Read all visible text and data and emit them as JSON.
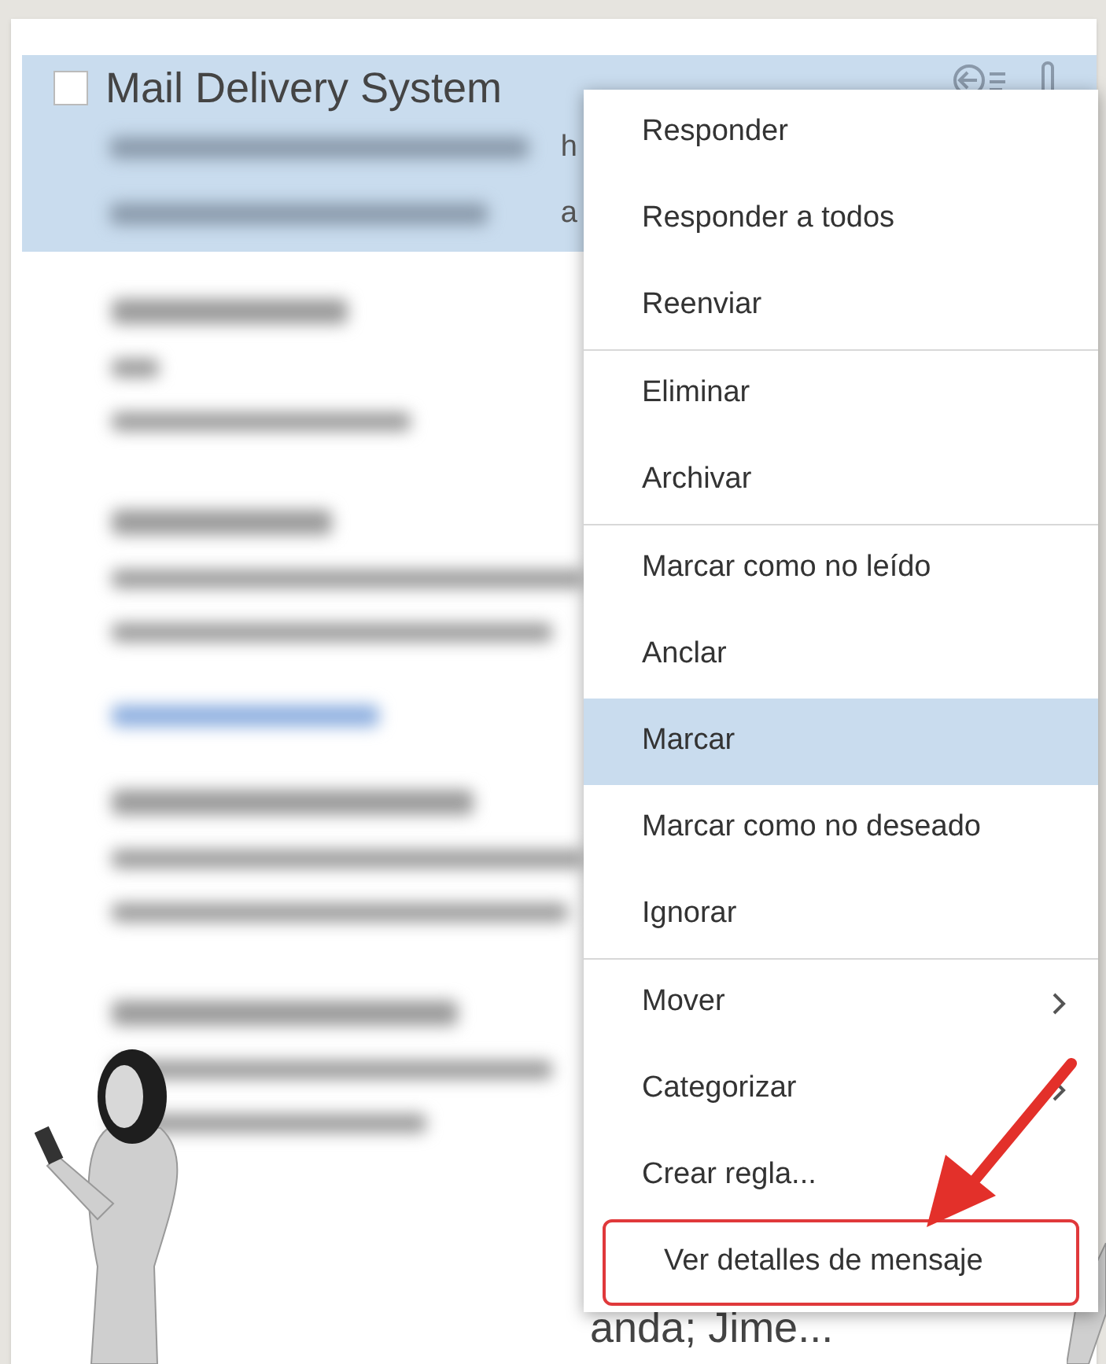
{
  "message_list": {
    "selected_row": {
      "selected": true,
      "checked": false,
      "sender": "Mail Delivery System",
      "preview_fragments": [
        "h",
        "a"
      ]
    },
    "bottom_row_fragment": "anda; Jime..."
  },
  "context_menu": {
    "groups": [
      [
        {
          "label": "Responder",
          "selected": false,
          "submenu": false,
          "outlined": false
        },
        {
          "label": "Responder a todos",
          "selected": false,
          "submenu": false,
          "outlined": false
        },
        {
          "label": "Reenviar",
          "selected": false,
          "submenu": false,
          "outlined": false
        }
      ],
      [
        {
          "label": "Eliminar",
          "selected": false,
          "submenu": false,
          "outlined": false
        },
        {
          "label": "Archivar",
          "selected": false,
          "submenu": false,
          "outlined": false
        }
      ],
      [
        {
          "label": "Marcar como no leído",
          "selected": false,
          "submenu": false,
          "outlined": false
        },
        {
          "label": "Anclar",
          "selected": false,
          "submenu": false,
          "outlined": false
        },
        {
          "label": "Marcar",
          "selected": true,
          "submenu": false,
          "outlined": false
        },
        {
          "label": "Marcar como no deseado",
          "selected": false,
          "submenu": false,
          "outlined": false
        },
        {
          "label": "Ignorar",
          "selected": false,
          "submenu": false,
          "outlined": false
        }
      ],
      [
        {
          "label": "Mover",
          "selected": false,
          "submenu": true,
          "outlined": false
        },
        {
          "label": "Categorizar",
          "selected": false,
          "submenu": true,
          "outlined": false
        },
        {
          "label": "Crear regla...",
          "selected": false,
          "submenu": false,
          "outlined": false
        },
        {
          "label": "Ver detalles de mensaje",
          "selected": false,
          "submenu": false,
          "outlined": true
        }
      ]
    ]
  }
}
